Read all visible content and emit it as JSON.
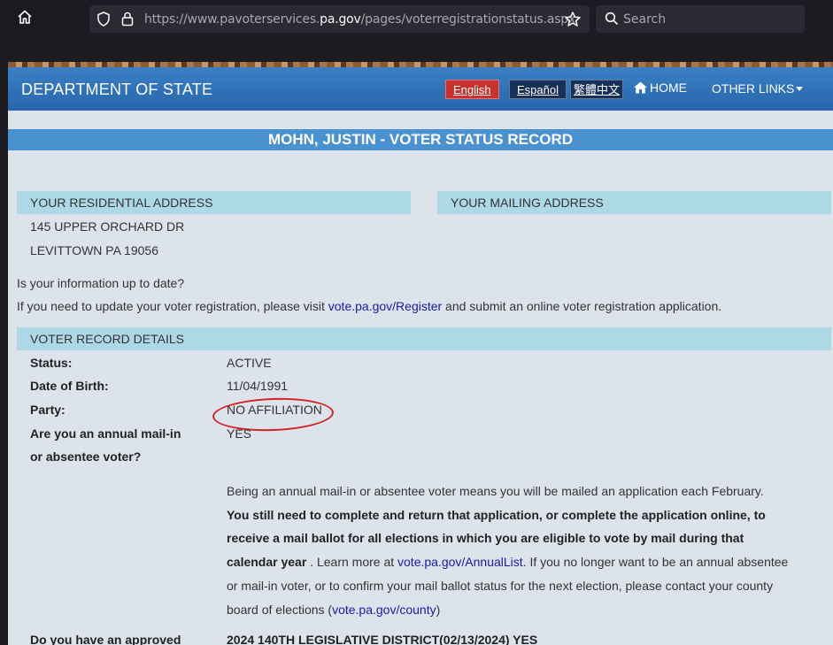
{
  "browser": {
    "url_prefix": "https://www.pavoterservices.",
    "url_domain": "pa.gov",
    "url_suffix": "/pages/voterregistrationstatus.aspx",
    "search_placeholder": "Search"
  },
  "navbar": {
    "department": "DEPARTMENT OF STATE",
    "lang_english": "English",
    "lang_spanish": "Español",
    "lang_chinese": "繁體中文",
    "home": "HOME",
    "other_links": "OTHER LINKS"
  },
  "record_title": "MOHN, JUSTIN - VOTER STATUS RECORD",
  "residential": {
    "header": "YOUR RESIDENTIAL ADDRESS",
    "line1": "145 UPPER ORCHARD DR",
    "line2": "LEVITTOWN PA 19056"
  },
  "mailing": {
    "header": "YOUR MAILING ADDRESS"
  },
  "update": {
    "question": "Is your information up to date?",
    "text_before": "If you need to update your voter registration, please visit ",
    "link": "vote.pa.gov/Register",
    "text_after": " and submit an online voter registration application."
  },
  "details": {
    "header": "VOTER RECORD DETAILS",
    "status_label": "Status:",
    "status_value": "ACTIVE",
    "dob_label": "Date of Birth:",
    "dob_value": "11/04/1991",
    "party_label": "Party:",
    "party_value": "NO AFFILIATION",
    "mailin_label_1": "Are you an annual mail-in",
    "mailin_label_2": "or absentee voter?",
    "mailin_value": "YES",
    "info_1": "Being an annual mail-in or absentee voter means you will be mailed an application each February.",
    "info_bold": "You still need to complete and return that application, or complete the application online, to receive a mail ballot for all elections in which you are eligible to vote by mail during that calendar year",
    "info_2": " . Learn more at ",
    "info_link_1": "vote.pa.gov/AnnualList",
    "info_3": ". If you no longer want to be an annual absentee or mail-in voter, or to confirm your mail ballot status for the next election, please contact your county board of elections (",
    "info_link_2": "vote.pa.gov/county",
    "info_4": ")",
    "approved_label": "Do you have an approved",
    "approved_value": "2024 140TH LEGISLATIVE DISTRICT(02/13/2024) YES"
  },
  "colors": {
    "navbar": "#2a6fb5",
    "title_bar": "#4a91cf",
    "section_header": "#add8e6",
    "english_btn": "#c8312e",
    "annotation_circle": "#d42026",
    "link": "#1a1aa6"
  }
}
